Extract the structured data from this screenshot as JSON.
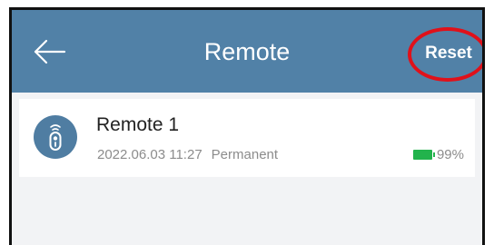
{
  "header": {
    "title": "Remote",
    "back_icon": "back-arrow-icon",
    "reset_label": "Reset",
    "background_color": "#5181a7",
    "highlight_color": "#e0111a"
  },
  "remotes": [
    {
      "name": "Remote 1",
      "date": "2022.06.03 11:27",
      "type": "Permanent",
      "battery": "99%",
      "battery_level": 0.99,
      "battery_color": "#22b34c",
      "icon": "remote-control-icon"
    }
  ]
}
